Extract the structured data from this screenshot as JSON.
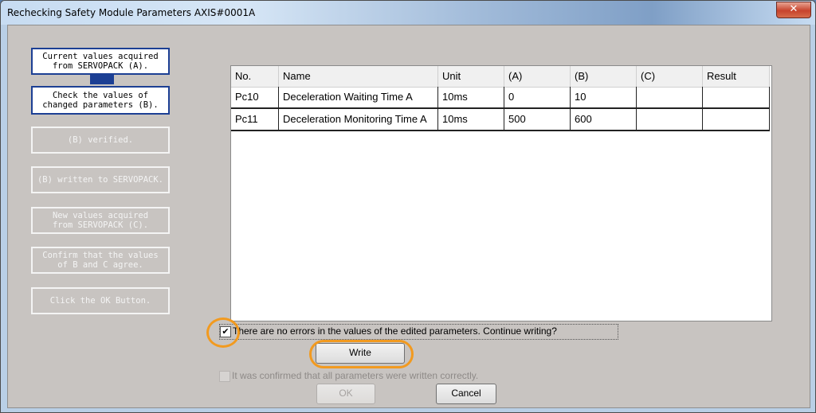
{
  "window": {
    "title": "Rechecking Safety Module Parameters AXIS#0001A",
    "close_glyph": "✕"
  },
  "steps": [
    {
      "label": "Current values acquired\nfrom SERVOPACK (A).",
      "state": "active"
    },
    {
      "label": "Check the values of\nchanged parameters (B).",
      "state": "active"
    },
    {
      "label": "(B) verified.",
      "state": "inactive"
    },
    {
      "label": "(B) written to SERVOPACK.",
      "state": "inactive"
    },
    {
      "label": "New values acquired\nfrom SERVOPACK (C).",
      "state": "inactive"
    },
    {
      "label": "Confirm that the values\nof B and C agree.",
      "state": "inactive"
    },
    {
      "label": "Click the OK Button.",
      "state": "inactive"
    }
  ],
  "table": {
    "columns": [
      "No.",
      "Name",
      "Unit",
      "(A)",
      "(B)",
      "(C)",
      "Result"
    ],
    "rows": [
      [
        "Pc10",
        "Deceleration Waiting Time A",
        "10ms",
        "0",
        "10",
        "",
        ""
      ],
      [
        "Pc11",
        "Deceleration Monitoring Time A",
        "10ms",
        "500",
        "600",
        "",
        ""
      ]
    ]
  },
  "confirm_check": {
    "label": "There are no errors in the values of the edited parameters. Continue writing?",
    "checked": true,
    "mark": "✔"
  },
  "write_button": {
    "label": "Write"
  },
  "written_check": {
    "label": "It was confirmed that all parameters were written correctly.",
    "checked": false
  },
  "ok_button": {
    "label": "OK",
    "enabled": false
  },
  "cancel_button": {
    "label": "Cancel"
  },
  "colors": {
    "accent": "#1c3f94",
    "highlight": "#f29a1f",
    "client_bg": "#c8c4c1"
  }
}
